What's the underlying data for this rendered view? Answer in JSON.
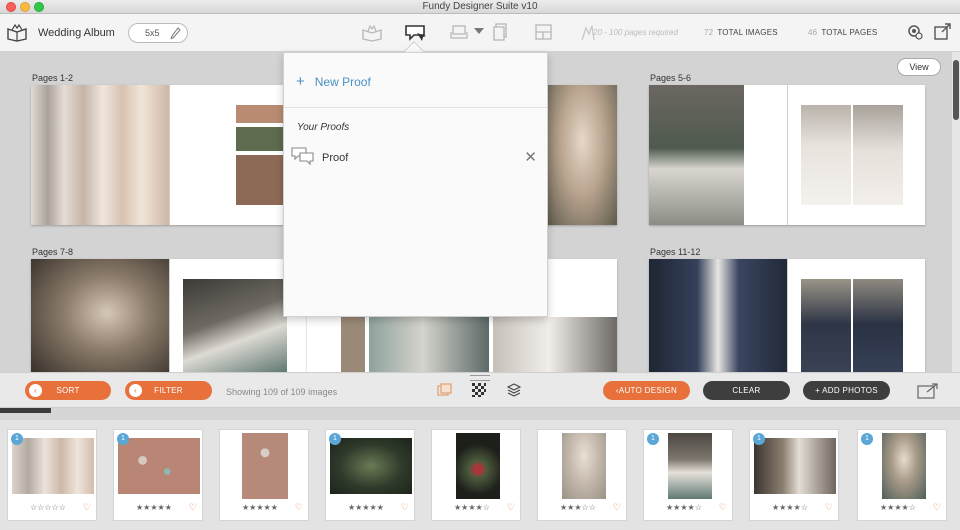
{
  "window": {
    "title": "Fundy Designer Suite v10"
  },
  "toolbar": {
    "album_name": "Wedding Album",
    "size": "5x5",
    "pages_required": "20 - 100 pages required",
    "total_images_count": "72",
    "total_images_label": "TOTAL IMAGES",
    "total_pages_count": "46",
    "total_pages_label": "TOTAL PAGES"
  },
  "canvas": {
    "view_label": "View",
    "spreads": [
      {
        "label": "Pages 1-2"
      },
      {
        "label": "Pages 5-6"
      },
      {
        "label": "Pages 7-8"
      },
      {
        "label": "Pages 11-12"
      }
    ]
  },
  "proof_menu": {
    "new_proof_label": "New Proof",
    "section_title": "Your Proofs",
    "items": [
      {
        "label": "Proof"
      }
    ]
  },
  "bottombar": {
    "sort_label": "SORT",
    "filter_label": "FILTER",
    "showing_text": "Showing 109 of 109 images",
    "auto_design_label": "AUTO DESIGN",
    "clear_label": "CLEAR",
    "add_photos_label": "+ ADD PHOTOS"
  },
  "tray": {
    "scroll_progress": 0.053,
    "thumbs": [
      {
        "badge": "1",
        "rating": 0,
        "stars": "☆☆☆☆☆"
      },
      {
        "badge": "1",
        "rating": 5,
        "stars": "★★★★★"
      },
      {
        "badge": "",
        "rating": 5,
        "stars": "★★★★★"
      },
      {
        "badge": "1",
        "rating": 5,
        "stars": "★★★★★"
      },
      {
        "badge": "",
        "rating": 4,
        "stars": "★★★★☆"
      },
      {
        "badge": "",
        "rating": 3,
        "stars": "★★★☆☆"
      },
      {
        "badge": "1",
        "rating": 4,
        "stars": "★★★★☆"
      },
      {
        "badge": "1",
        "rating": 4,
        "stars": "★★★★☆"
      },
      {
        "badge": "1",
        "rating": 4,
        "stars": "★★★★☆"
      }
    ]
  },
  "colors": {
    "accent": "#e8703a",
    "link": "#4a90c2",
    "badge": "#5aa6d6",
    "dark_button": "#3e3e3e"
  }
}
